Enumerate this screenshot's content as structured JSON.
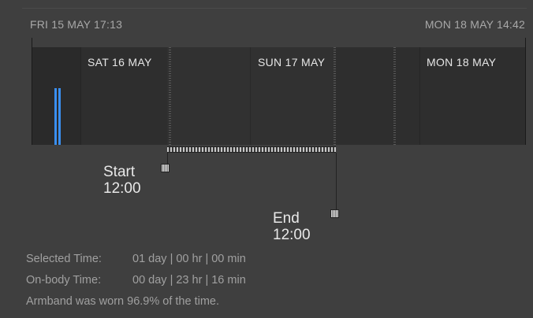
{
  "range": {
    "start": "FRI 15 MAY 17:13",
    "end": "MON 18 MAY 14:42"
  },
  "days": [
    {
      "label": "SAT 16 MAY"
    },
    {
      "label": "SUN 17 MAY"
    },
    {
      "label": "MON 18 MAY"
    }
  ],
  "markers": {
    "start_label": "Start",
    "start_time": "12:00",
    "end_label": "End",
    "end_time": "12:00"
  },
  "stats": {
    "selected_label": "Selected Time:",
    "selected_value": "01 day | 00 hr | 00 min",
    "onbody_label": "On-body Time:",
    "onbody_value": "00 day | 23 hr | 16 min",
    "worn_text": "Armband was worn 96.9% of the time."
  },
  "colors": {
    "activity": "#3a8ff0"
  }
}
